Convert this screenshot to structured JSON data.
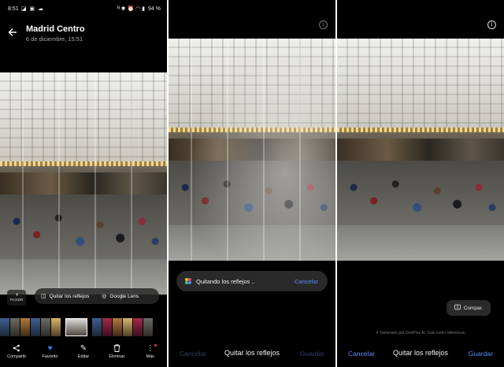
{
  "status_bar": {
    "time": "8:51",
    "left_icons": "◪ ▣ ☁",
    "right_icons": "ᴺ ✱ ⏰ ◠ ▮",
    "battery": "94 %"
  },
  "panel1": {
    "title": "Madrid Centro",
    "subtitle": "6 de diciembre, 15:51",
    "proxdr_label": "ProXDR",
    "action_reflect": "Quitar los reflejos",
    "action_lens": "Google Lens",
    "nav": [
      {
        "label": "Compartir",
        "icon": "share-icon",
        "glyph": "⩤"
      },
      {
        "label": "Favorito",
        "icon": "heart-icon",
        "glyph": "♥"
      },
      {
        "label": "Editar",
        "icon": "pencil-icon",
        "glyph": "✎"
      },
      {
        "label": "Eliminar",
        "icon": "trash-icon",
        "glyph": "🗑"
      },
      {
        "label": "Más",
        "icon": "more-icon",
        "glyph": "⋮"
      }
    ]
  },
  "panel2": {
    "progress_label": "Quitando los reflejos ..",
    "progress_cancel": "Cancelar",
    "footer_cancel": "Cancelar",
    "footer_title": "Quitar los reflejos",
    "footer_save": "Guardar"
  },
  "panel3": {
    "compare_label": "Compar.",
    "ai_note": "Generado por OnePlus AI. Solo como referencia.",
    "footer_cancel": "Cancelar",
    "footer_title": "Quitar los reflejos",
    "footer_save": "Guardar"
  },
  "colors": {
    "accent_blue": "#5b8df5",
    "disabled_blue": "#2d3f64",
    "favorite_blue": "#3d7bf3",
    "pill_bg": "#2a2a2a"
  }
}
